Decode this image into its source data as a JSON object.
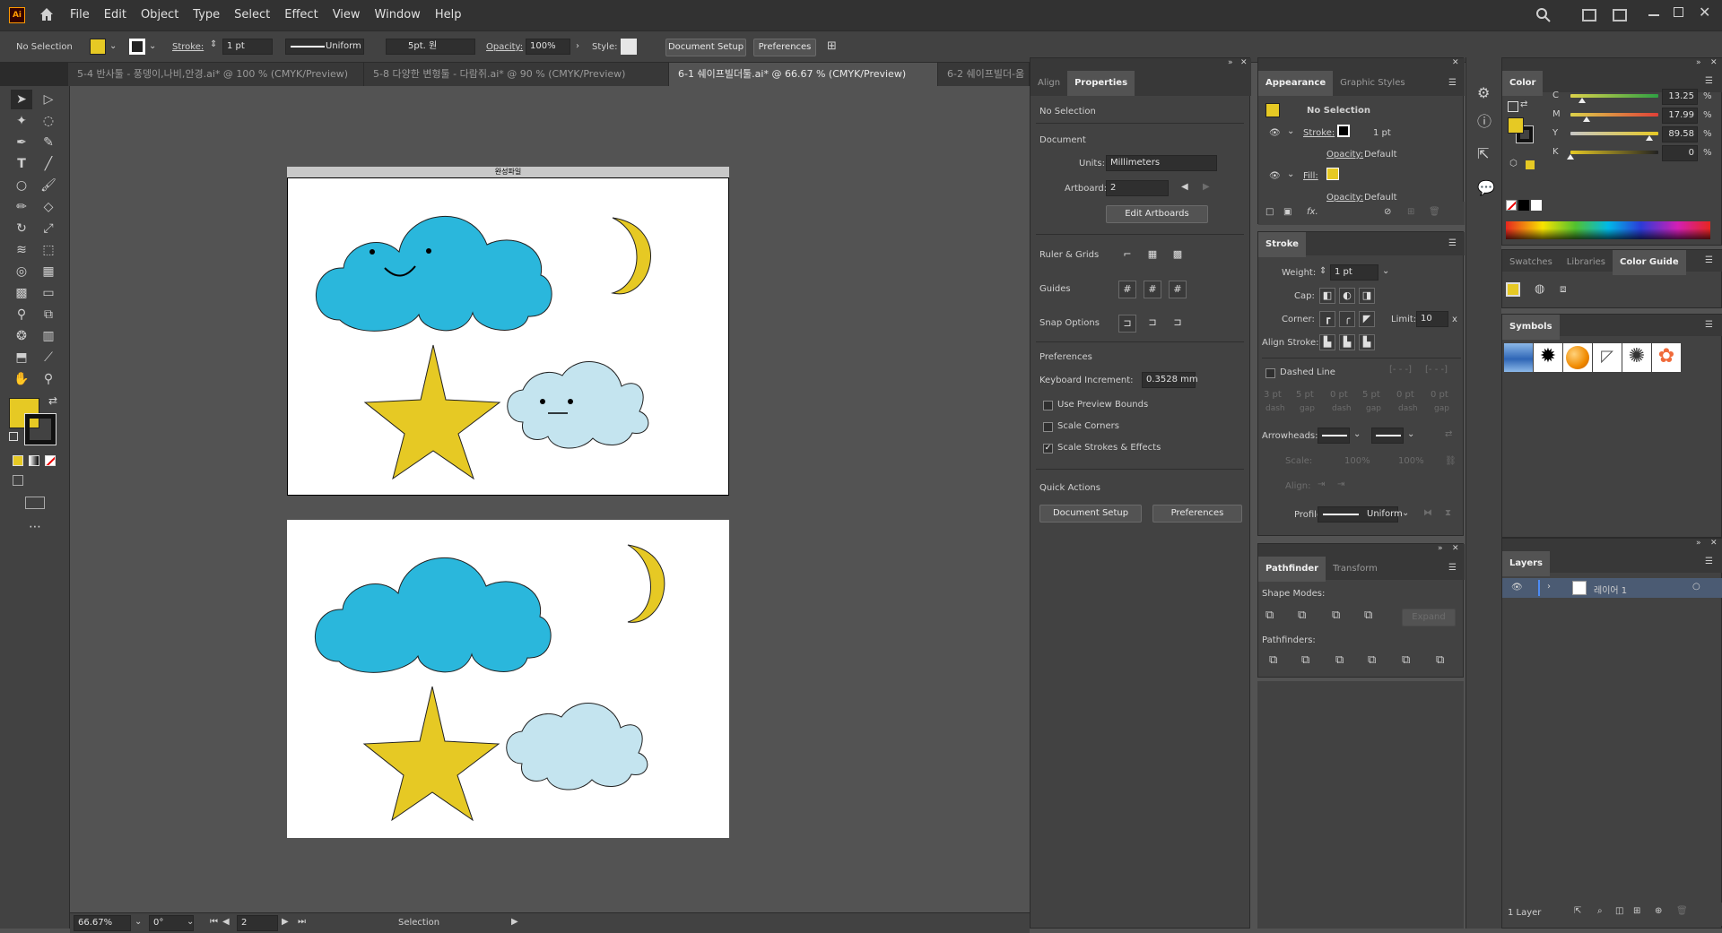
{
  "app": {
    "logo": "Ai",
    "menus": [
      "File",
      "Edit",
      "Object",
      "Type",
      "Select",
      "Effect",
      "View",
      "Window",
      "Help"
    ]
  },
  "control": {
    "selection": "No Selection",
    "stroke_label": "Stroke:",
    "stroke_value": "1 pt",
    "profile": "Uniform",
    "brush": "5pt. 원",
    "opacity_label": "Opacity:",
    "opacity_value": "100%",
    "style_label": "Style:",
    "doc_setup": "Document Setup",
    "preferences": "Preferences"
  },
  "doc_tabs": [
    "5-4 반사툴 - 풍뎅이,나비,안경.ai* @ 100 % (CMYK/Preview)",
    "5-8 다양한 변형툴 - 다람쥐.ai* @ 90 % (CMYK/Preview)",
    "6-1 쉐이프빌더툴.ai* @ 66.67 % (CMYK/Preview)",
    "6-2 쉐이프빌더-움"
  ],
  "artboard1": {
    "title": "완성파일"
  },
  "status": {
    "zoom": "66.67%",
    "rotate": "0°",
    "artboard": "2",
    "tool": "Selection"
  },
  "colors": {
    "fill": "#e6c924",
    "cloud_blue": "#2ab7dc",
    "cloud_light": "#c4e4ef",
    "star": "#e6c924"
  },
  "properties": {
    "tabs": [
      "Align",
      "Properties"
    ],
    "no_selection": "No Selection",
    "document": "Document",
    "units_label": "Units:",
    "units_value": "Millimeters",
    "artboard_label": "Artboard:",
    "artboard_value": "2",
    "edit_artboards": "Edit Artboards",
    "ruler_grids": "Ruler & Grids",
    "guides": "Guides",
    "snap_options": "Snap Options",
    "preferences_header": "Preferences",
    "kb_label": "Keyboard Increment:",
    "kb_value": "0.3528 mm",
    "use_preview": "Use Preview Bounds",
    "scale_corners": "Scale Corners",
    "scale_strokes": "Scale Strokes & Effects",
    "quick_actions": "Quick Actions",
    "doc_setup": "Document Setup",
    "preferences": "Preferences"
  },
  "appearance": {
    "tabs": [
      "Appearance",
      "Graphic Styles"
    ],
    "no_selection": "No Selection",
    "stroke": "Stroke:",
    "stroke_val": "1 pt",
    "opacity1": "Opacity:",
    "default1": "Default",
    "fill": "Fill:",
    "opacity2": "Opacity:",
    "default2": "Default",
    "fx": "fx."
  },
  "stroke": {
    "title": "Stroke",
    "weight": "Weight:",
    "weight_val": "1 pt",
    "cap": "Cap:",
    "corner": "Corner:",
    "limit": "Limit:",
    "limit_val": "10",
    "limit_unit": "x",
    "align": "Align Stroke:",
    "dashed": "Dashed Line",
    "dash_vals": [
      "3 pt",
      "5 pt",
      "0 pt",
      "5 pt",
      "0 pt",
      "0 pt"
    ],
    "dash_lbls": [
      "dash",
      "gap",
      "dash",
      "gap",
      "dash",
      "gap"
    ],
    "arrowheads": "Arrowheads:",
    "scale": "Scale:",
    "scale1": "100%",
    "scale2": "100%",
    "alignlbl": "Align:",
    "profile": "Profile:",
    "profile_val": "Uniform"
  },
  "pathfinder": {
    "tabs": [
      "Pathfinder",
      "Transform"
    ],
    "shape_modes": "Shape Modes:",
    "expand": "Expand",
    "pathfinders": "Pathfinders:"
  },
  "color": {
    "title": "Color",
    "channels": [
      {
        "name": "C",
        "value": "13.25",
        "pct": 13.25
      },
      {
        "name": "M",
        "value": "17.99",
        "pct": 17.99
      },
      {
        "name": "Y",
        "value": "89.58",
        "pct": 89.58
      },
      {
        "name": "K",
        "value": "0",
        "pct": 0
      }
    ],
    "unit": "%"
  },
  "swatches": {
    "tabs": [
      "Swatches",
      "Libraries",
      "Color Guide"
    ]
  },
  "symbols": {
    "title": "Symbols"
  },
  "layers": {
    "title": "Layers",
    "layer_name": "레이어 1",
    "count": "1 Layer"
  }
}
